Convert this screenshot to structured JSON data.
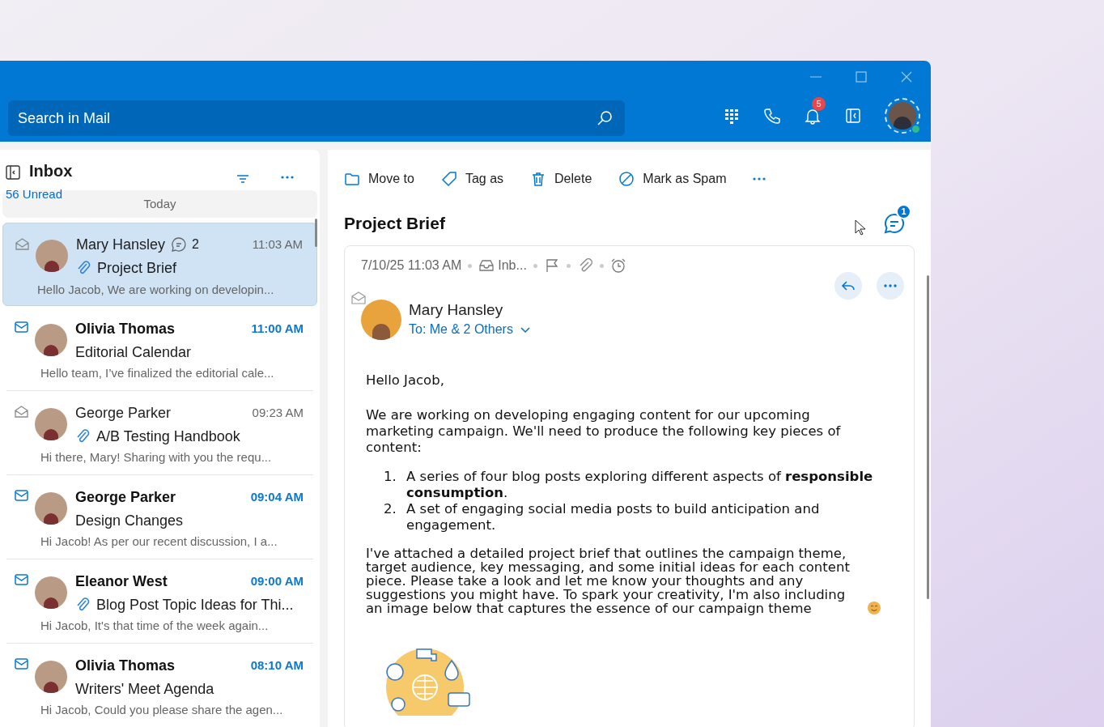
{
  "search": {
    "placeholder": "Search in Mail"
  },
  "header": {
    "notification_count": "5"
  },
  "mail_list": {
    "folder": "Inbox",
    "unread": "56 Unread",
    "group": "Today",
    "messages": [
      {
        "sender": "Mary Hansley",
        "time": "11:03 AM",
        "subject": "Project Brief",
        "preview": "Hello Jacob, We are working on developin...",
        "unread": false,
        "selected": true,
        "attachment": true,
        "comments": "2"
      },
      {
        "sender": "Olivia Thomas",
        "time": "11:00 AM",
        "subject": "Editorial Calendar",
        "preview": "Hello team, I’ve finalized the editorial cale...",
        "unread": true,
        "selected": false,
        "attachment": false
      },
      {
        "sender": "George Parker",
        "time": "09:23 AM",
        "subject": "A/B Testing Handbook",
        "preview": "Hi there, Mary! Sharing with you the requ...",
        "unread": false,
        "selected": false,
        "attachment": true
      },
      {
        "sender": "George Parker",
        "time": "09:04 AM",
        "subject": "Design Changes",
        "preview": "Hi Jacob! As per our recent discussion, I a...",
        "unread": true,
        "selected": false,
        "attachment": false
      },
      {
        "sender": "Eleanor West",
        "time": "09:00 AM",
        "subject": "Blog Post Topic Ideas for Thi...",
        "preview": "Hi Jacob, It's that time of the week again...",
        "unread": true,
        "selected": false,
        "attachment": true
      },
      {
        "sender": "Olivia Thomas",
        "time": "08:10 AM",
        "subject": "Writers' Meet Agenda",
        "preview": "Hi Jacob, Could you please share the agen...",
        "unread": true,
        "selected": false,
        "attachment": false
      }
    ]
  },
  "toolbar": [
    {
      "kind": "move",
      "label": "Move to"
    },
    {
      "kind": "tag",
      "label": "Tag as"
    },
    {
      "kind": "delete",
      "label": "Delete"
    },
    {
      "kind": "spam",
      "label": "Mark as Spam"
    }
  ],
  "reading": {
    "subject": "Project Brief",
    "comment_count": "1",
    "date": "7/10/25 11:03 AM",
    "folder": "Inb...",
    "sender": "Mary Hansley",
    "recipients": "To: Me & 2 Others",
    "greeting": "Hello Jacob,",
    "intro": "We are working on developing engaging content for our upcoming marketing campaign. We'll need to produce the following key pieces of content:",
    "items": [
      {
        "number": "1.",
        "text": "A series of four blog posts exploring different aspects of **responsible consumption**."
      },
      {
        "number": "2.",
        "text": "A set of engaging social media posts to build anticipation and engagement."
      }
    ],
    "closing": "I've attached a detailed project brief that outlines the campaign theme, target audience, key messaging, and some initial ideas for each content piece. Please take a look and let me know your thoughts and any suggestions you might have. To spark your creativity, I'm also including an image below that captures the essence of our campaign theme"
  }
}
